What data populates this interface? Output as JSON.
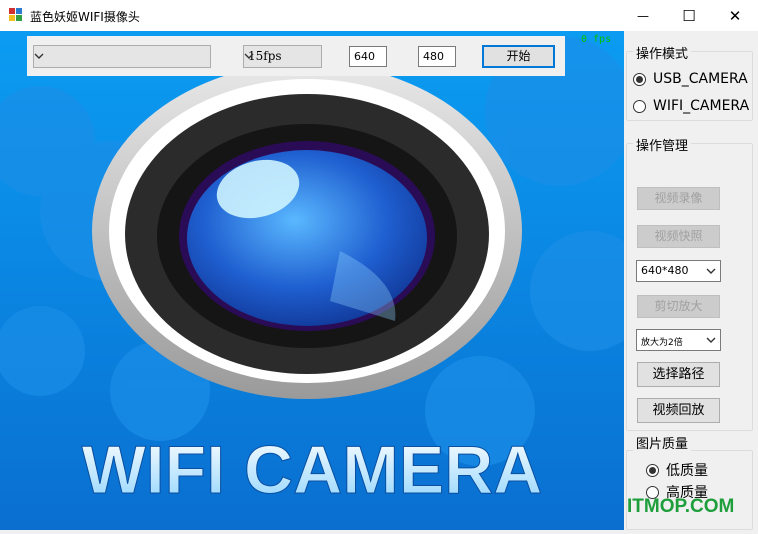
{
  "window": {
    "title": "蓝色妖姬WIFI摄像头",
    "minimize_glyph": "—",
    "maximize_glyph": "☐",
    "close_glyph": "✕"
  },
  "toolbar": {
    "device_value": "",
    "fps_value": "15fps",
    "width_value": "640",
    "height_value": "480",
    "start_label": "开始"
  },
  "preview": {
    "fps_readout": "0 fps",
    "banner_text": "WIFI CAMERA"
  },
  "mode_group": {
    "title": "操作模式",
    "options": [
      {
        "label": "USB_CAMERA",
        "checked": true
      },
      {
        "label": "WIFI_CAMERA",
        "checked": false
      }
    ]
  },
  "manage_group": {
    "title": "操作管理",
    "record_label": "视频录像",
    "snapshot_label": "视频快照",
    "resolution_value": "640*480",
    "crop_zoom_label": "剪切放大",
    "zoom_value": "放大为2倍",
    "choose_path_label": "选择路径",
    "playback_label": "视频回放"
  },
  "quality_group": {
    "title": "图片质量",
    "options": [
      {
        "label": "低质量",
        "checked": true
      },
      {
        "label": "高质量",
        "checked": false
      }
    ]
  },
  "watermark": "ITMOP.COM",
  "colors": {
    "preview_blue": "#0a84e0",
    "accent": "#0078d7",
    "watermark_green": "#1e9f3c",
    "fps_green": "#00c000"
  }
}
